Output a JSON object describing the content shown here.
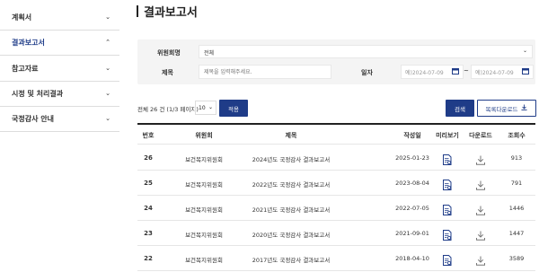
{
  "sidebar": {
    "items": [
      {
        "label": "계획서",
        "chevron": "⌄",
        "active": false
      },
      {
        "label": "결과보고서",
        "chevron": "⌃",
        "active": true
      },
      {
        "label": "참고자료",
        "chevron": "⌄",
        "active": false
      },
      {
        "label": "시정 및 처리결과",
        "chevron": "⌄",
        "active": false
      },
      {
        "label": "국정감사 안내",
        "chevron": "⌄",
        "active": false
      }
    ]
  },
  "page": {
    "title": "결과보고서"
  },
  "search": {
    "committee_label": "위원회명",
    "committee_value": "전체",
    "subject_label": "제목",
    "subject_placeholder": "제목을 입력해주세요.",
    "date_label": "일자",
    "date_from_placeholder": "예)2024-07-09",
    "date_to_placeholder": "예)2024-07-09",
    "tilde": "~"
  },
  "toolbar": {
    "total_text": "전체 26 건 (1/3 페이지)",
    "per_page": "10",
    "apply_label": "적용",
    "search_label": "검색",
    "download_label": "목록다운로드"
  },
  "table": {
    "headers": [
      "번호",
      "위원회",
      "제목",
      "작성일",
      "미리보기",
      "다운로드",
      "조회수"
    ],
    "rows": [
      {
        "no": "26",
        "committee": "보건복지위원회",
        "title": "2024년도 국정감사 결과보고서",
        "date": "2025-01-23",
        "views": "913"
      },
      {
        "no": "25",
        "committee": "보건복지위원회",
        "title": "2022년도 국정감사 결과보고서",
        "date": "2023-08-04",
        "views": "791"
      },
      {
        "no": "24",
        "committee": "보건복지위원회",
        "title": "2021년도 국정감사 결과보고서",
        "date": "2022-07-05",
        "views": "1446"
      },
      {
        "no": "23",
        "committee": "보건복지위원회",
        "title": "2020년도 국정감사 결과보고서",
        "date": "2021-09-01",
        "views": "1447"
      },
      {
        "no": "22",
        "committee": "보건복지위원회",
        "title": "2017년도 국정감사 결과보고서",
        "date": "2018-04-10",
        "views": "3589"
      }
    ]
  },
  "icons": {
    "calendar": "calendar-icon",
    "preview": "document-preview-icon",
    "download": "download-icon"
  },
  "colors": {
    "primary": "#1f3c88",
    "panel": "#f4f4f4"
  }
}
